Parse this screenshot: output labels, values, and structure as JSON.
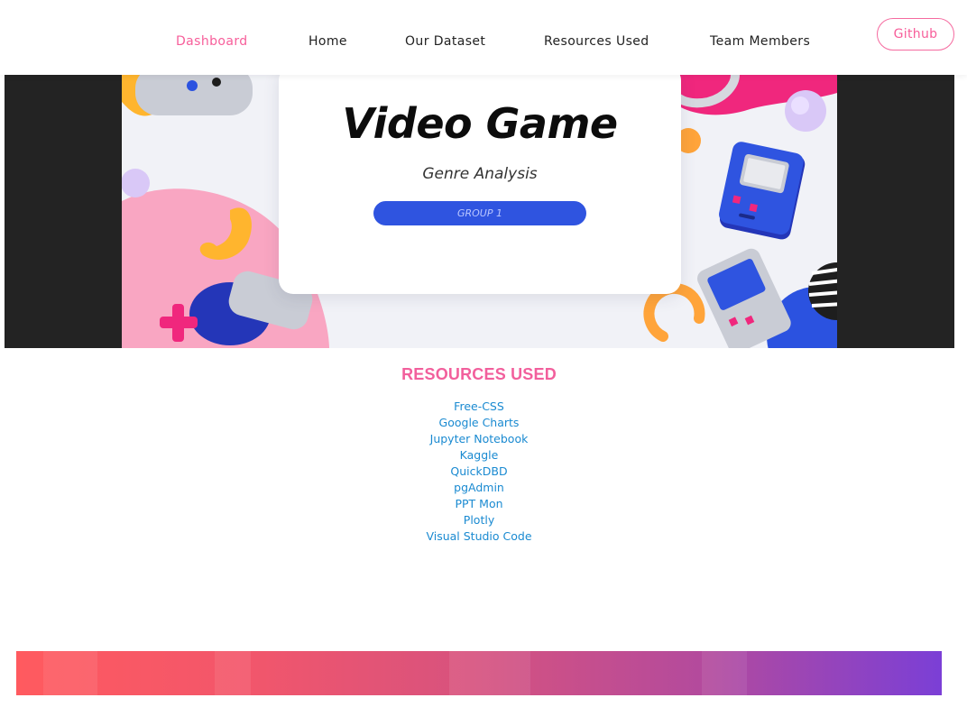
{
  "nav": {
    "items": [
      {
        "label": "Dashboard",
        "active": true
      },
      {
        "label": "Home",
        "active": false
      },
      {
        "label": "Our Dataset",
        "active": false
      },
      {
        "label": "Resources Used",
        "active": false
      },
      {
        "label": "Team Members",
        "active": false
      }
    ],
    "github_label": "Github"
  },
  "hero": {
    "title": "Video Game",
    "subtitle": "Genre Analysis",
    "pill": "GROUP 1"
  },
  "resources": {
    "heading": "RESOURCES USED",
    "links": [
      "Free-CSS",
      "Google Charts",
      "Jupyter Notebook",
      "Kaggle",
      "QuickDBD",
      "pgAdmin",
      "PPT Mon",
      "Plotly",
      "Visual Studio Code"
    ]
  },
  "colors": {
    "accent": "#f75e9a",
    "link": "#1a8ad1",
    "hero_bg": "#232323",
    "pill": "#2f54e0"
  }
}
